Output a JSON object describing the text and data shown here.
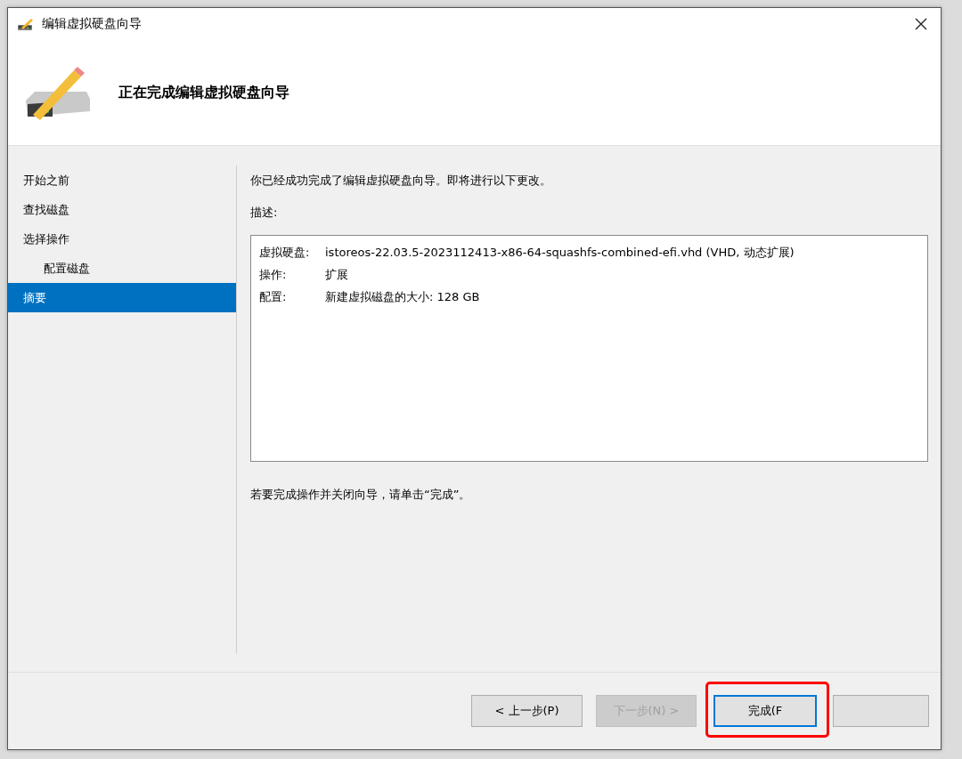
{
  "window": {
    "title": "编辑虚拟硬盘向导"
  },
  "header": {
    "title": "正在完成编辑虚拟硬盘向导"
  },
  "sidebar": {
    "items": [
      {
        "label": "开始之前",
        "selected": false
      },
      {
        "label": "查找磁盘",
        "selected": false
      },
      {
        "label": "选择操作",
        "selected": false,
        "children": [
          {
            "label": "配置磁盘",
            "selected": false
          }
        ]
      },
      {
        "label": "摘要",
        "selected": true
      }
    ]
  },
  "content": {
    "intro": "你已经成功完成了编辑虚拟硬盘向导。即将进行以下更改。",
    "description_label": "描述:",
    "summary": [
      {
        "key": "虚拟硬盘:",
        "value": "istoreos-22.03.5-2023112413-x86-64-squashfs-combined-efi.vhd (VHD, 动态扩展)"
      },
      {
        "key": "操作:",
        "value": "扩展"
      },
      {
        "key": "配置:",
        "value": "新建虚拟磁盘的大小: 128 GB"
      }
    ],
    "footer_note": "若要完成操作并关闭向导，请单击“完成”。"
  },
  "buttons": [
    {
      "label": "< 上一步(P)",
      "disabled": false,
      "default": false,
      "highlighted": false
    },
    {
      "label": "下一步(N) >",
      "disabled": true,
      "default": false,
      "highlighted": false
    },
    {
      "label": "完成(F",
      "disabled": false,
      "default": true,
      "highlighted": true
    },
    {
      "disabled": false,
      "default": false,
      "highlighted": false
    }
  ]
}
